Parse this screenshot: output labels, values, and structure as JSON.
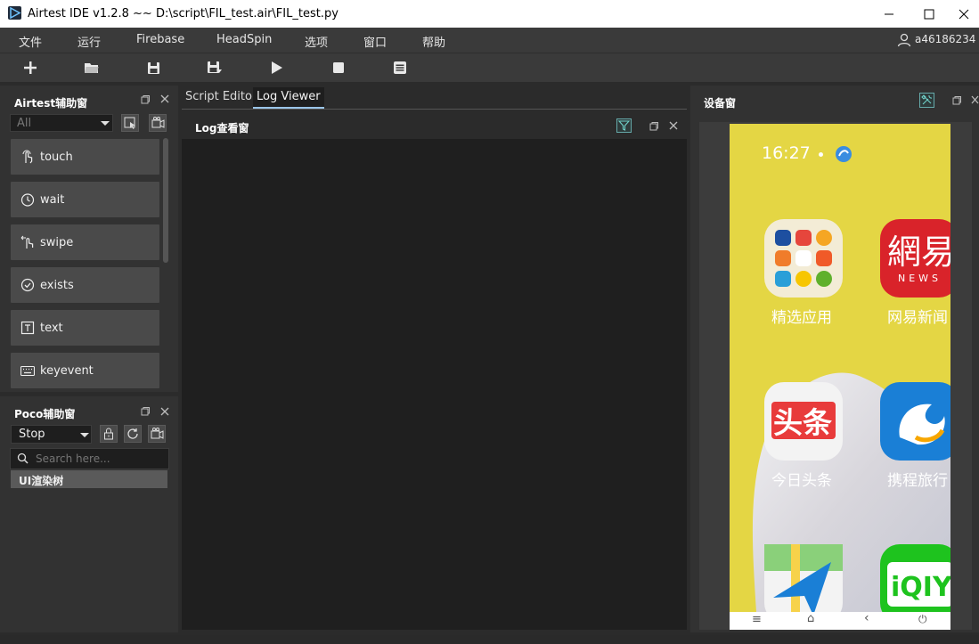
{
  "window": {
    "title": "Airtest IDE v1.2.8 ~~ D:\\script\\FIL_test.air\\FIL_test.py",
    "minimize": "—",
    "maximize": "☐",
    "close": "✕"
  },
  "menu": {
    "items": [
      "文件",
      "运行",
      "Firebase",
      "HeadSpin",
      "选项",
      "窗口",
      "帮助"
    ],
    "user": "a46186234"
  },
  "toolbar": {
    "icons": [
      "new-icon",
      "open-folder-icon",
      "save-icon",
      "save-as-icon",
      "play-icon",
      "stop-icon",
      "log-icon"
    ]
  },
  "airtest_panel": {
    "title": "Airtest辅助窗",
    "filter_value": "All",
    "actions": [
      "touch",
      "wait",
      "swipe",
      "exists",
      "text",
      "keyevent"
    ]
  },
  "poco_panel": {
    "title": "Poco辅助窗",
    "mode_value": "Stop",
    "search_placeholder": "Search here...",
    "tree_root": "UI渲染树"
  },
  "editor": {
    "tabs": [
      "Script Editor",
      "Log Viewer"
    ],
    "active_tab": "Log Viewer",
    "log_title": "Log查看窗"
  },
  "device_panel": {
    "title": "设备窗",
    "time": "16:27",
    "apps": [
      "精选应用",
      "网易新闻",
      "今日头条",
      "携程旅行"
    ],
    "nav": [
      "≡",
      "⌂",
      "‹",
      "⏻"
    ],
    "colors": {
      "background": "#e4d644",
      "netease": "#d9232a",
      "toutiao": "#e83b3b",
      "ctrip": "#1a7fd6",
      "iqiyi": "#1ec31e"
    }
  }
}
